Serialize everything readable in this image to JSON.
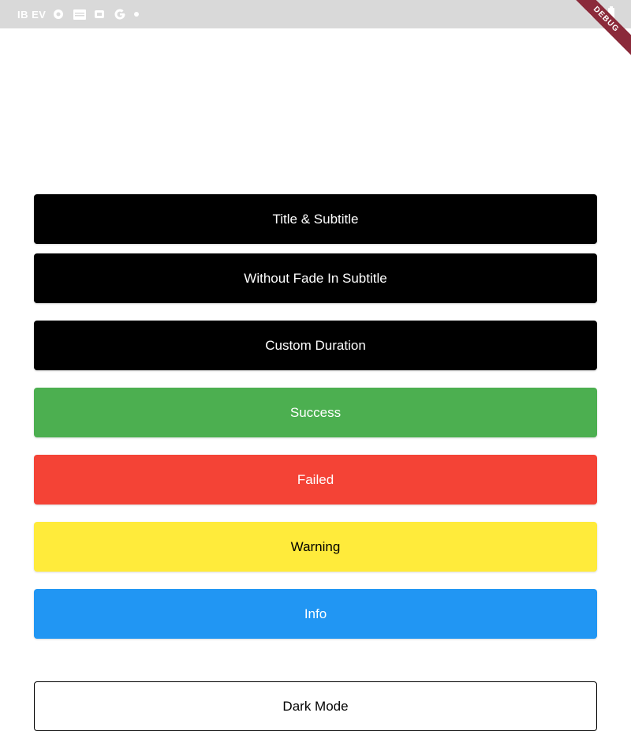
{
  "status_bar": {
    "left_text": "IB EV",
    "icons": [
      "settings-icon",
      "calendar-icon",
      "cast-icon",
      "google-icon",
      "dot-icon"
    ],
    "right_icons": [
      "wifi-icon",
      "battery-icon"
    ]
  },
  "debug_banner": {
    "label": "DEBUG"
  },
  "buttons": {
    "title_subtitle": "Title & Subtitle",
    "without_fade": "Without Fade In Subtitle",
    "custom_duration": "Custom Duration",
    "success": "Success",
    "failed": "Failed",
    "warning": "Warning",
    "info": "Info",
    "dark_mode": "Dark Mode"
  },
  "colors": {
    "black": "#000000",
    "success": "#4caf50",
    "failed": "#f44336",
    "warning": "#ffeb3b",
    "info": "#2196f3",
    "debug_ribbon": "#8b2a3a"
  }
}
